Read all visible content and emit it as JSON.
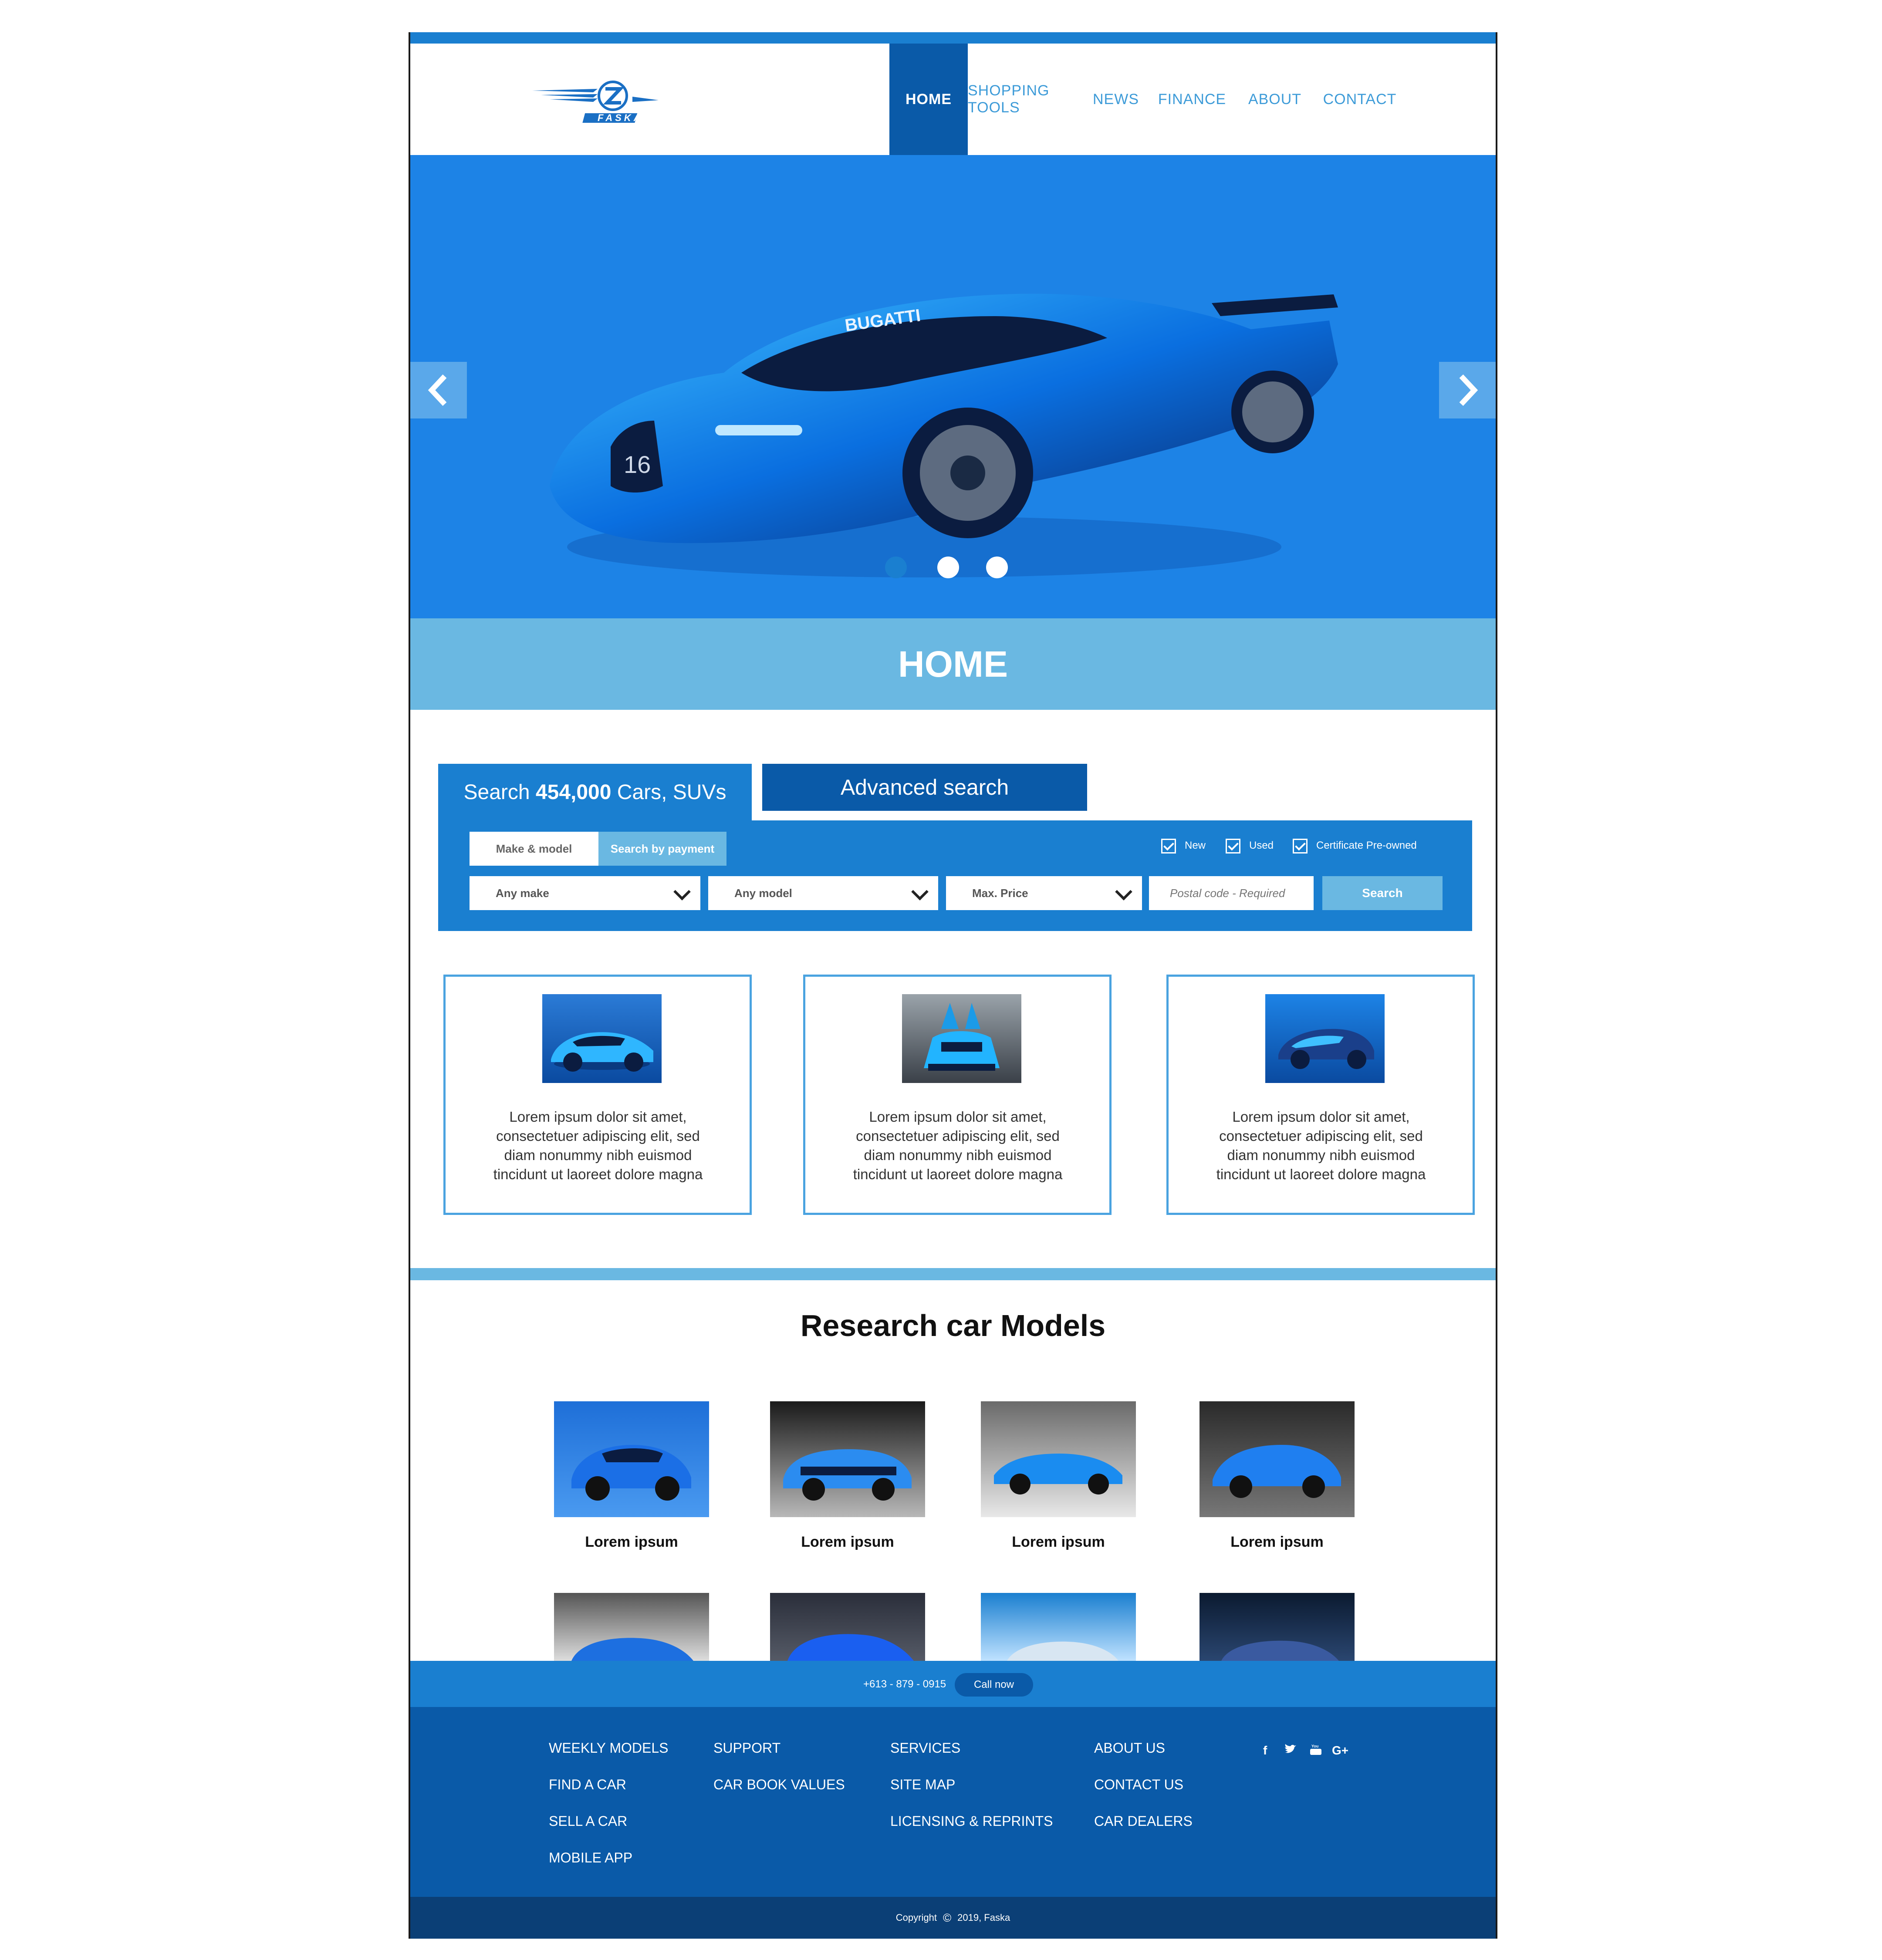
{
  "brand": {
    "name": "FASKA"
  },
  "nav": [
    {
      "label": "HOME",
      "active": true
    },
    {
      "label": "SHOPPING TOOLS",
      "active": false
    },
    {
      "label": "NEWS",
      "active": false
    },
    {
      "label": "FINANCE",
      "active": false
    },
    {
      "label": "ABOUT",
      "active": false
    },
    {
      "label": "CONTACT",
      "active": false
    }
  ],
  "hero": {
    "car_badge": "BUGATTI",
    "car_number": "16",
    "slides_total": 3,
    "active_slide": 1
  },
  "home_band": {
    "title": "HOME"
  },
  "search": {
    "tab_prefix": "Search ",
    "tab_count": "454,000",
    "tab_suffix": " Cars, SUVs",
    "advanced_tab": "Advanced search",
    "subtab_make": "Make & model",
    "subtab_payment": "Search by payment",
    "checkbox_new": "New",
    "checkbox_used": "Used",
    "checkbox_cpo": "Certificate Pre-owned",
    "any_make": "Any make",
    "any_model": "Any model",
    "max_price": "Max. Price",
    "postal_placeholder": "Postal code - Required",
    "search_button": "Search"
  },
  "cards": [
    {
      "line1": "Lorem ipsum dolor sit amet,",
      "line2": "consectetuer adipiscing elit, sed",
      "line3": "diam nonummy nibh euismod",
      "line4": "tincidunt ut laoreet dolore magna"
    },
    {
      "line1": "Lorem ipsum dolor sit amet,",
      "line2": "consectetuer adipiscing elit, sed",
      "line3": "diam nonummy nibh euismod",
      "line4": "tincidunt ut laoreet dolore magna"
    },
    {
      "line1": "Lorem ipsum dolor sit amet,",
      "line2": "consectetuer adipiscing elit, sed",
      "line3": "diam nonummy nibh euismod",
      "line4": "tincidunt ut laoreet dolore magna"
    }
  ],
  "research": {
    "title": "Research car Models",
    "models": [
      "Lorem ipsum",
      "Lorem ipsum",
      "Lorem ipsum",
      "Lorem ipsum"
    ]
  },
  "callbar": {
    "phone": "+613 - 879 - 0915",
    "button": "Call now"
  },
  "footer": {
    "col1": [
      "WEEKLY MODELS",
      "FIND A CAR",
      "SELL A CAR",
      "MOBILE APP"
    ],
    "col2": [
      "SUPPORT",
      "CAR BOOK VALUES"
    ],
    "col3": [
      "SERVICES",
      "SITE MAP",
      "LICENSING & REPRINTS"
    ],
    "col4": [
      "ABOUT US",
      "CONTACT US",
      "CAR DEALERS"
    ],
    "social": [
      "f",
      "t",
      "yt",
      "G+"
    ]
  },
  "copyright": {
    "prefix": "Copyright",
    "symbol": "©",
    "text": "2019, Faska"
  },
  "colors": {
    "primary": "#1a7fd0",
    "dark": "#0a5aa8",
    "light": "#6ab8e2",
    "footer_bottom": "#0b3f76"
  }
}
